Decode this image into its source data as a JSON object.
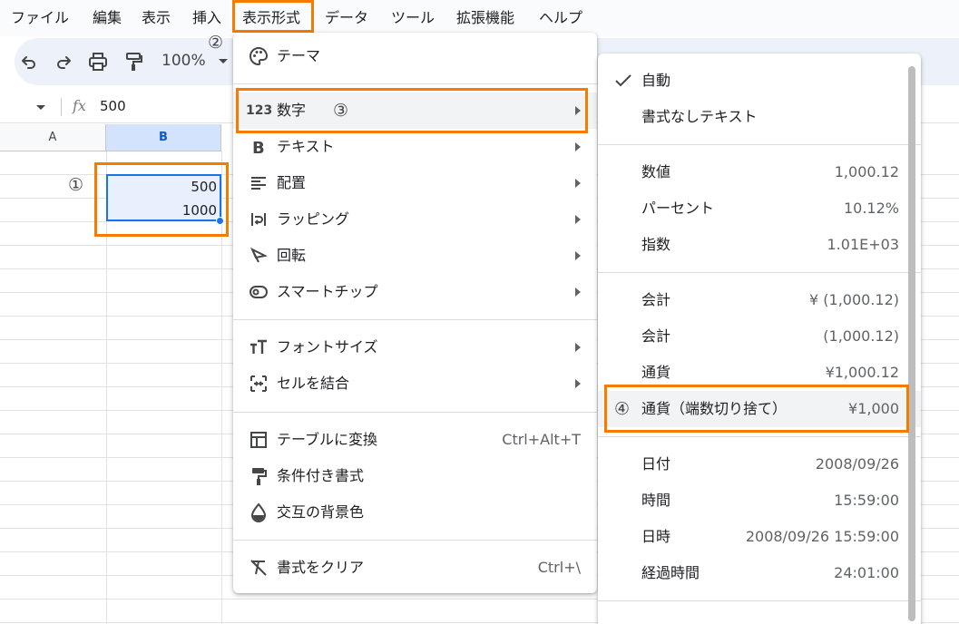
{
  "menubar": {
    "items": [
      "ファイル",
      "編集",
      "表示",
      "挿入",
      "表示形式",
      "データ",
      "ツール",
      "拡張機能",
      "ヘルプ"
    ],
    "active_index": 4
  },
  "toolbar": {
    "zoom": "100%"
  },
  "formula_bar": {
    "fx": "fx",
    "value": "500"
  },
  "grid": {
    "columns": [
      "A",
      "B"
    ],
    "selected_column": "B",
    "cells": [
      "500",
      "1000"
    ]
  },
  "annotations": {
    "step1": "①",
    "step2": "②",
    "step3": "③",
    "step4": "④",
    "highlight_color": "#f57c00"
  },
  "format_menu": {
    "items": [
      {
        "label": "テーマ",
        "icon": "palette-icon"
      },
      {
        "label": "数字",
        "icon": "number-123-icon",
        "submenu": true
      },
      {
        "label": "テキスト",
        "icon": "bold-icon",
        "submenu": true
      },
      {
        "label": "配置",
        "icon": "align-left-icon",
        "submenu": true
      },
      {
        "label": "ラッピング",
        "icon": "text-wrap-icon",
        "submenu": true
      },
      {
        "label": "回転",
        "icon": "text-rotate-icon",
        "submenu": true
      },
      {
        "label": "スマートチップ",
        "icon": "smart-chip-icon",
        "submenu": true
      },
      {
        "label": "フォントサイズ",
        "icon": "font-size-icon",
        "submenu": true
      },
      {
        "label": "セルを結合",
        "icon": "merge-cells-icon",
        "submenu": true
      },
      {
        "label": "テーブルに変換",
        "icon": "table-icon",
        "shortcut": "Ctrl+Alt+T"
      },
      {
        "label": "条件付き書式",
        "icon": "paint-roller-icon"
      },
      {
        "label": "交互の背景色",
        "icon": "fill-drop-icon"
      },
      {
        "label": "書式をクリア",
        "icon": "clear-format-icon",
        "shortcut": "Ctrl+\\"
      }
    ]
  },
  "number_submenu": {
    "items": [
      {
        "label": "自動",
        "value": "",
        "checked": true
      },
      {
        "label": "書式なしテキスト",
        "value": ""
      },
      {
        "label": "数値",
        "value": "1,000.12"
      },
      {
        "label": "パーセント",
        "value": "10.12%"
      },
      {
        "label": "指数",
        "value": "1.01E+03"
      },
      {
        "label": "会計",
        "value": "¥ (1,000.12)"
      },
      {
        "label": "会計",
        "value": "(1,000.12)"
      },
      {
        "label": "通貨",
        "value": "¥1,000.12"
      },
      {
        "label": "通貨（端数切り捨て）",
        "value": "¥1,000"
      },
      {
        "label": "日付",
        "value": "2008/09/26"
      },
      {
        "label": "時間",
        "value": "15:59:00"
      },
      {
        "label": "日時",
        "value": "2008/09/26 15:59:00"
      },
      {
        "label": "経過時間",
        "value": "24:01:00"
      }
    ]
  }
}
